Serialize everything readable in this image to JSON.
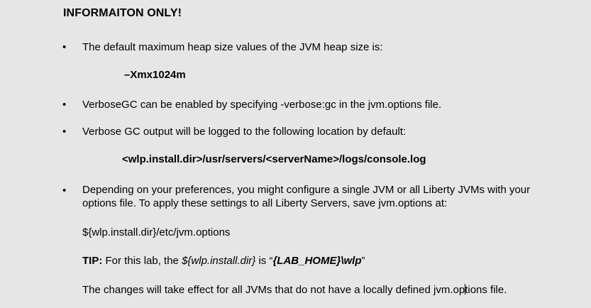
{
  "heading": "INFORMAITON ONLY!",
  "bullet_glyph": "•",
  "items": {
    "heap_text": "The default maximum heap size values of the JVM heap size is:",
    "heap_value": "–Xmx1024m",
    "verbose_text": "VerboseGC can be enabled by specifying -verbose:gc in the jvm.options file.",
    "log_text": "Verbose GC output will be logged to the following location by default:",
    "log_path": "<wlp.install.dir>/usr/servers/<serverName>/logs/console.log",
    "prefs_line1": "Depending on your preferences, you might configure a single JVM or all Liberty JVMs with your",
    "prefs_line2": "options file. To apply these settings to all Liberty Servers, save jvm.options at:",
    "options_path": "${wlp.install.dir}/etc/jvm.options",
    "tip_label": "TIP:",
    "tip_text_a": " For this lab, the ",
    "tip_italic": "${wlp.install.dir}",
    "tip_text_b": " is “",
    "tip_bold_italic": "{LAB_HOME}\\wlp",
    "tip_text_c": "”",
    "changes_text_a": "The changes will take effect for all JVMs that do not have a locally defined jvm.op",
    "changes_text_b": "tions file."
  }
}
